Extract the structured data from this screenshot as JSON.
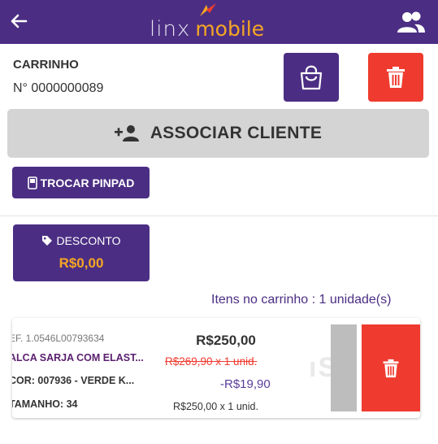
{
  "header": {
    "back_icon": "arrow-left-icon",
    "logo": {
      "part1": "linx",
      "part2": "mobile"
    },
    "users_icon": "users-icon",
    "colors": {
      "bar": "#4b2e83",
      "accent": "#f5a623"
    }
  },
  "cart": {
    "title": "CARRINHO",
    "number": "N° 0000000089",
    "bag_icon": "shopping-bag-icon",
    "trash_icon": "trash-icon"
  },
  "actions": {
    "associate_label": "ASSOCIAR CLIENTE",
    "associate_icon": "add-user-icon",
    "pinpad_label": "TROCAR PINPAD",
    "pinpad_icon": "device-icon"
  },
  "discount": {
    "label": "DESCONTO",
    "value": "R$0,00",
    "icon": "tag-icon"
  },
  "items_summary": "Itens no carrinho : 1 unidade(s)",
  "item": {
    "ref": "EF. 1.0546L00793634",
    "name": "ALCA SARJA COM ELAST...",
    "color": "COR: 007936 - VERDE K...",
    "size": "TAMANHO: 34",
    "price": "R$250,00",
    "old_price": "R$269,90 x 1 unid.",
    "discount": "-R$19,90",
    "unit_price": "R$250,00 x 1 unid.",
    "delete_icon": "trash-icon",
    "colors": {
      "delete": "#ef3b2f",
      "strike": "#ef3b2f"
    }
  }
}
